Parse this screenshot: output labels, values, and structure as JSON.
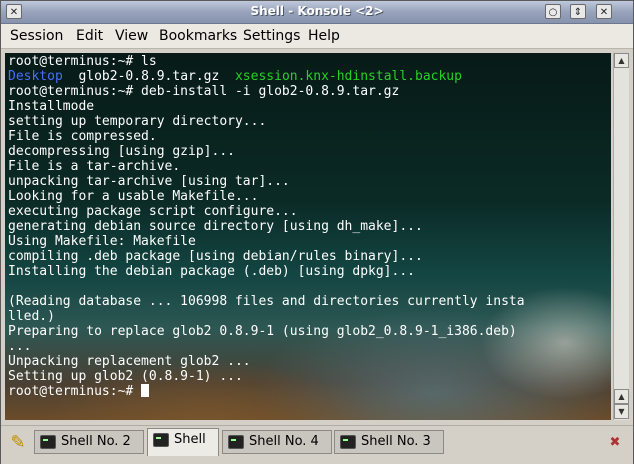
{
  "window": {
    "title": "Shell - Konsole <2>"
  },
  "menu": [
    "Session",
    "Edit",
    "View",
    "Bookmarks",
    "Settings",
    "Help"
  ],
  "terminal": {
    "l0": "root@terminus:~# ls",
    "l1a": "Desktop",
    "l1b": "  glob2-0.8.9.tar.gz  ",
    "l1c": "xsession.knx-hdinstall.backup",
    "l2": "root@terminus:~# deb-install -i glob2-0.8.9.tar.gz",
    "l3": "Installmode",
    "l4": "setting up temporary directory...",
    "l5": "File is compressed.",
    "l6": "decompressing [using gzip]...",
    "l7": "File is a tar-archive.",
    "l8": "unpacking tar-archive [using tar]...",
    "l9": "Looking for a usable Makefile...",
    "l10": "executing package script configure...",
    "l11": "generating debian source directory [using dh_make]...",
    "l12": "Using Makefile: Makefile",
    "l13": "compiling .deb package [using debian/rules binary]...",
    "l14": "Installing the debian package (.deb) [using dpkg]...",
    "l15": "",
    "l16": "(Reading database ... 106998 files and directories currently insta",
    "l17": "lled.)",
    "l18": "Preparing to replace glob2 0.8.9-1 (using glob2_0.8.9-1_i386.deb)",
    "l19": "...",
    "l20": "Unpacking replacement glob2 ...",
    "l21": "Setting up glob2 (0.8.9-1) ...",
    "prompt": "root@terminus:~# "
  },
  "tabs": [
    "Shell No. 2",
    "Shell",
    "Shell No. 4",
    "Shell No. 3"
  ],
  "icons": {
    "menu": "window-menu-icon",
    "minimize": "minimize-icon",
    "maximize": "maximize-icon",
    "close": "close-icon",
    "new_tab": "new-session-icon",
    "close_tab": "close-session-icon"
  }
}
